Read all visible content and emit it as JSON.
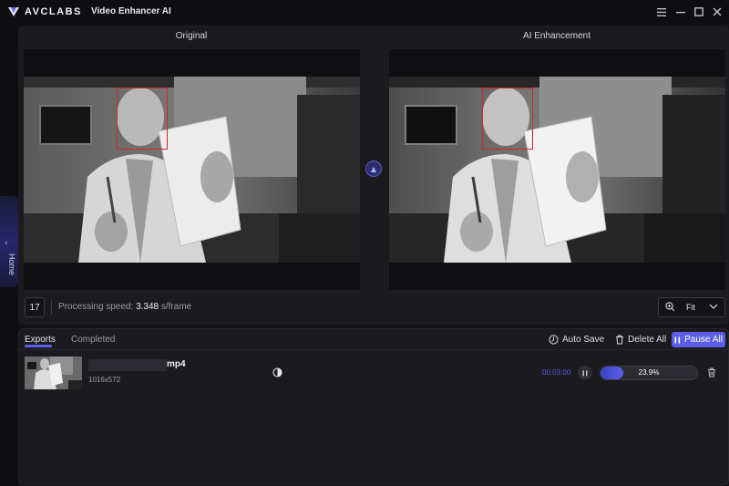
{
  "titlebar": {
    "brand": "AVCLABS",
    "app_title": "Video Enhancer AI",
    "icons": [
      "menu-icon",
      "minimize-icon",
      "maximize-icon",
      "close-icon"
    ]
  },
  "sidebar": {
    "home_label": "Home",
    "icon": "chevron-left-icon"
  },
  "preview": {
    "original_label": "Original",
    "enhanced_label": "AI Enhancement",
    "frame_number": "17",
    "speed_label": "Processing speed:",
    "speed_value": "3.348",
    "speed_unit": "s/frame",
    "zoom_value": "Fit"
  },
  "exports": {
    "tabs": [
      {
        "label": "Exports",
        "active": true
      },
      {
        "label": "Completed",
        "active": false
      }
    ],
    "actions": {
      "auto_save": "Auto Save",
      "delete_all": "Delete All",
      "pause_all": "Pause All"
    },
    "rows": [
      {
        "name_ext": "mp4",
        "resolution": "1016x572",
        "time": "00:03:00",
        "progress_percent": 23.9,
        "progress_text": "23.9%"
      }
    ]
  },
  "colors": {
    "accent": "#5b5ee8",
    "background": "#121214",
    "panel": "#1b1b1f",
    "face_box": "#d4252b"
  }
}
